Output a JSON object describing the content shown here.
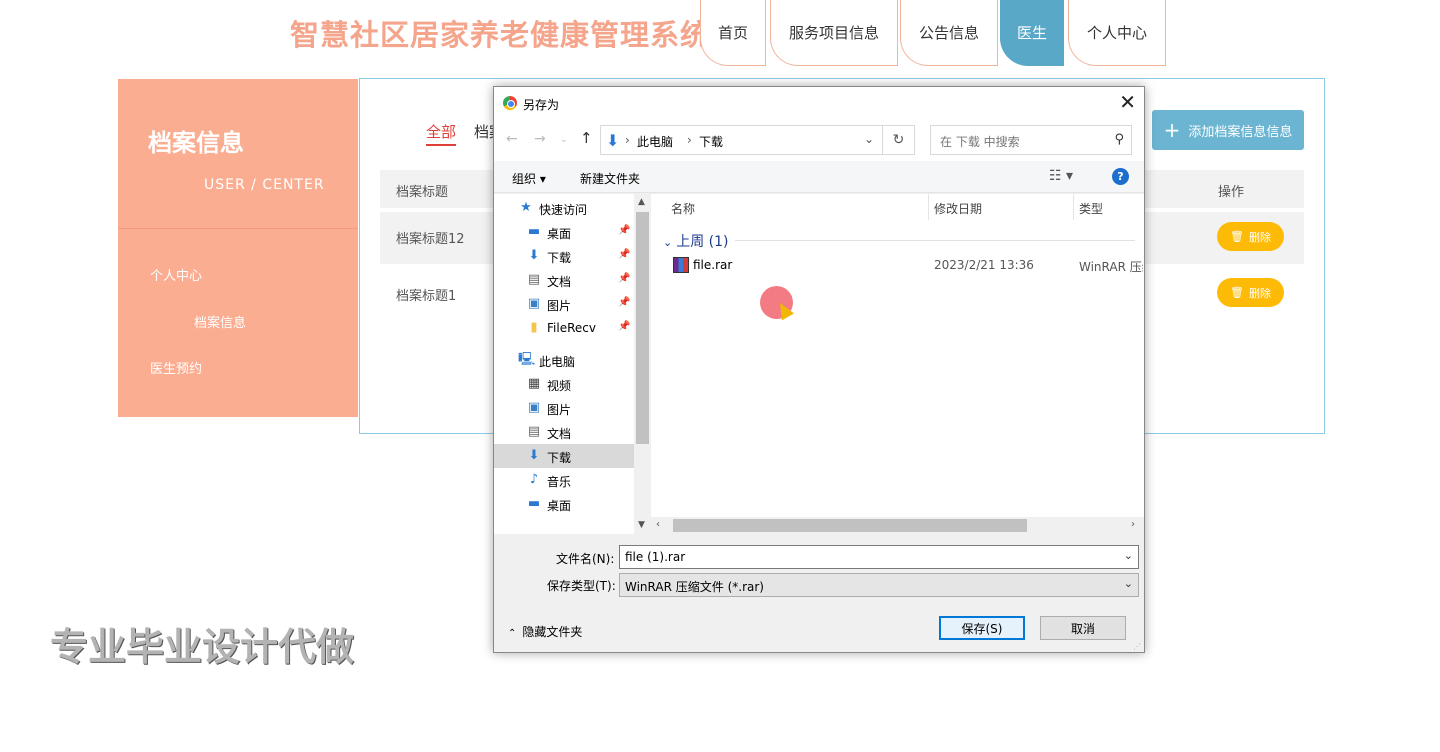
{
  "site": {
    "title": "智慧社区居家养老健康管理系统",
    "nav": [
      "首页",
      "服务项目信息",
      "公告信息",
      "医生",
      "个人中心"
    ],
    "active_nav": "医生"
  },
  "sidebar": {
    "title": "档案信息",
    "subtitle": "USER / CENTER",
    "links": [
      "个人中心",
      "档案信息",
      "医生预约"
    ]
  },
  "content": {
    "tab_all": "全部",
    "tab_2": "档案",
    "add_button": "添加档案信息信息",
    "headers": {
      "title": "档案标题",
      "op": "操作"
    },
    "rows": [
      "档案标题12",
      "档案标题1"
    ],
    "delete_label": "删除"
  },
  "watermark": "专业毕业设计代做",
  "dialog": {
    "title": "另存为",
    "breadcrumb": [
      "此电脑",
      "下载"
    ],
    "search_placeholder": "在 下载 中搜索",
    "toolbar": {
      "organize": "组织 ▾",
      "new_folder": "新建文件夹"
    },
    "tree": [
      {
        "label": "快速访问",
        "icon": "star-icon",
        "pinned": false
      },
      {
        "label": "桌面",
        "icon": "desktop-icon",
        "pinned": true
      },
      {
        "label": "下载",
        "icon": "download-icon",
        "pinned": true
      },
      {
        "label": "文档",
        "icon": "document-icon",
        "pinned": true
      },
      {
        "label": "图片",
        "icon": "picture-icon",
        "pinned": true
      },
      {
        "label": "FileRecv",
        "icon": "folder-icon",
        "pinned": true
      },
      {
        "label": "此电脑",
        "icon": "computer-icon",
        "pinned": false
      },
      {
        "label": "视频",
        "icon": "video-icon",
        "pinned": false
      },
      {
        "label": "图片",
        "icon": "picture-icon",
        "pinned": false
      },
      {
        "label": "文档",
        "icon": "document-icon",
        "pinned": false
      },
      {
        "label": "下载",
        "icon": "download-icon",
        "pinned": false
      },
      {
        "label": "音乐",
        "icon": "music-icon",
        "pinned": false
      },
      {
        "label": "桌面",
        "icon": "desktop-icon",
        "pinned": false
      }
    ],
    "columns": {
      "name": "名称",
      "modified": "修改日期",
      "type": "类型"
    },
    "group": "上周 (1)",
    "file": {
      "name": "file.rar",
      "modified": "2023/2/21 13:36",
      "type": "WinRAR 压缩"
    },
    "filename_label": "文件名(N):",
    "filename_value": "file (1).rar",
    "filetype_label": "保存类型(T):",
    "filetype_value": "WinRAR 压缩文件 (*.rar)",
    "hide_folders": "隐藏文件夹",
    "save": "保存(S)",
    "cancel": "取消"
  }
}
